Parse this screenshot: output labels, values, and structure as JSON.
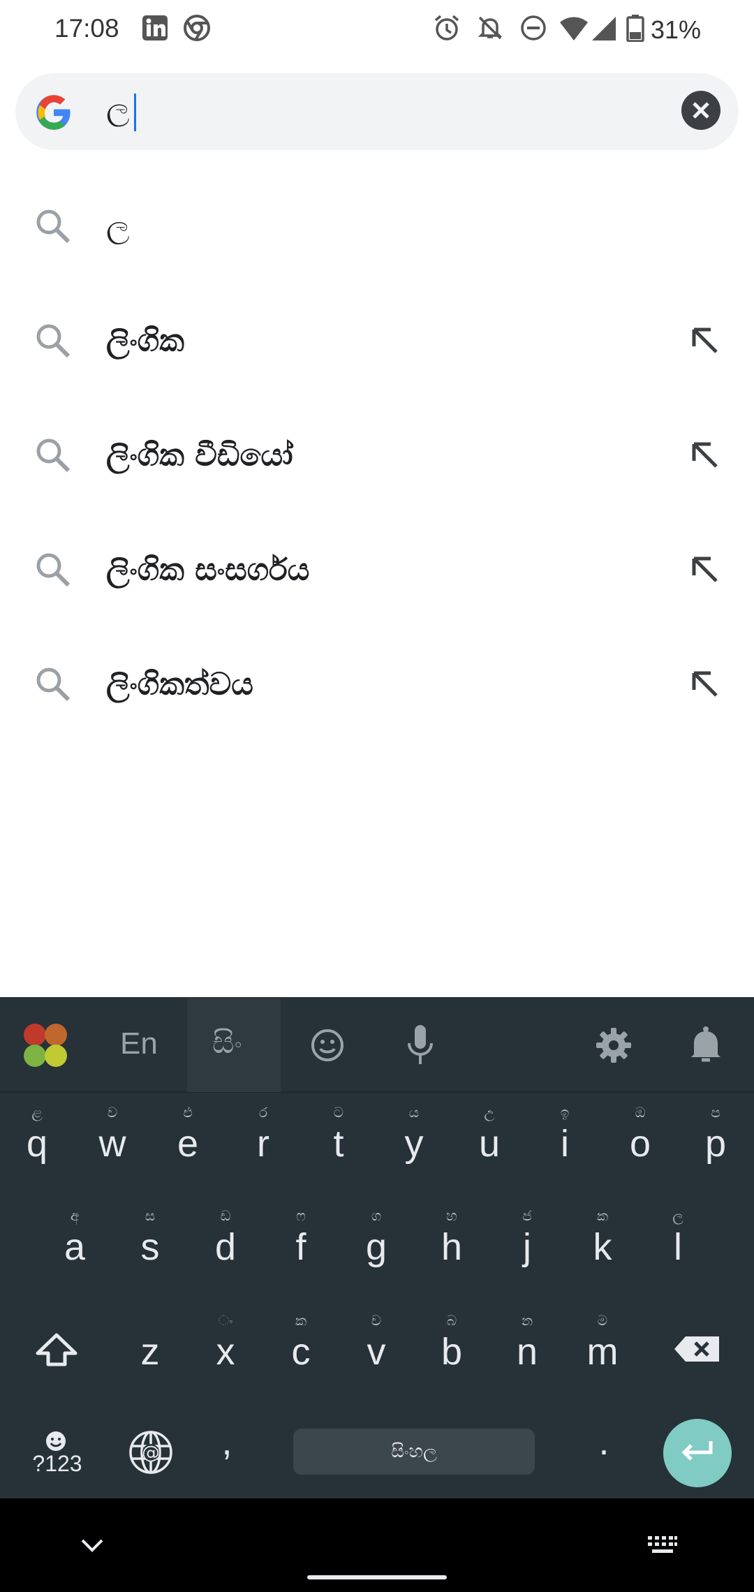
{
  "status_bar": {
    "time": "17:08",
    "battery": "31%",
    "icons": [
      "linkedin-icon",
      "chrome-icon",
      "alarm-icon",
      "bell-off-icon",
      "do-not-disturb-icon",
      "wifi-icon",
      "signal-icon",
      "battery-icon"
    ]
  },
  "search": {
    "query": "ල",
    "clear_icon": "close-icon"
  },
  "suggestions": [
    {
      "text": "ල",
      "bold": false,
      "fill_icon": false
    },
    {
      "text": "ලිංගික",
      "bold": true,
      "fill_icon": true
    },
    {
      "text": "ලිංගික වීඩියෝ",
      "bold": true,
      "fill_icon": true
    },
    {
      "text": "ලිංගික සංසර්ගය",
      "bold": true,
      "fill_icon": true
    },
    {
      "text": "ලිංගිකත්වය",
      "bold": true,
      "fill_icon": true
    }
  ],
  "keyboard": {
    "toolbar": {
      "lang_en": "En",
      "lang_si": "සිං",
      "icons": [
        "apps-icon",
        "emoji-icon",
        "microphone-icon",
        "settings-icon",
        "bell-icon"
      ]
    },
    "row1": [
      {
        "main": "q",
        "hint": "ළ"
      },
      {
        "main": "w",
        "hint": "ව"
      },
      {
        "main": "e",
        "hint": "එ"
      },
      {
        "main": "r",
        "hint": "ර"
      },
      {
        "main": "t",
        "hint": "ට"
      },
      {
        "main": "y",
        "hint": "ය"
      },
      {
        "main": "u",
        "hint": "උ"
      },
      {
        "main": "i",
        "hint": "ඉ"
      },
      {
        "main": "o",
        "hint": "ඔ"
      },
      {
        "main": "p",
        "hint": "ප"
      }
    ],
    "row2": [
      {
        "main": "a",
        "hint": "අ"
      },
      {
        "main": "s",
        "hint": "ස"
      },
      {
        "main": "d",
        "hint": "ඩ"
      },
      {
        "main": "f",
        "hint": "ෆ"
      },
      {
        "main": "g",
        "hint": "ග"
      },
      {
        "main": "h",
        "hint": "හ"
      },
      {
        "main": "j",
        "hint": "ජ"
      },
      {
        "main": "k",
        "hint": "ක"
      },
      {
        "main": "l",
        "hint": "ල"
      }
    ],
    "row3": [
      {
        "main": "z",
        "hint": ""
      },
      {
        "main": "x",
        "hint": "ං"
      },
      {
        "main": "c",
        "hint": "ක"
      },
      {
        "main": "v",
        "hint": "ච"
      },
      {
        "main": "b",
        "hint": "බ"
      },
      {
        "main": "n",
        "hint": "න"
      },
      {
        "main": "m",
        "hint": "ම"
      }
    ],
    "symbols_label": "?123",
    "comma": ",",
    "space_label": "සිංහල",
    "period": "."
  }
}
